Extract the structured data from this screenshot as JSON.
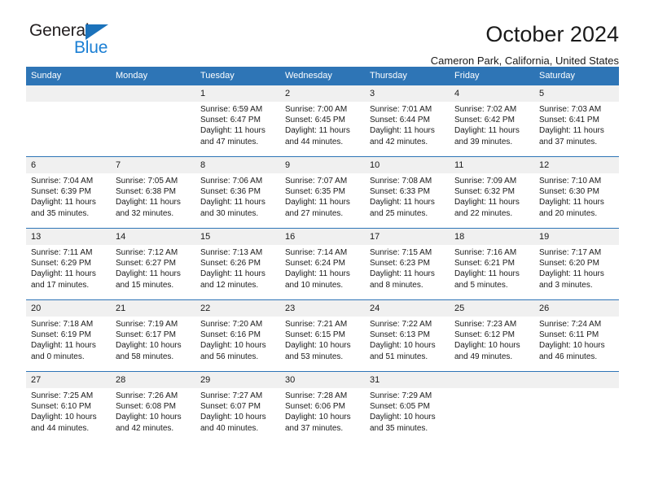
{
  "brand": {
    "name_top": "General",
    "name_bottom": "Blue",
    "accent_color": "#1b7fd4",
    "triangle_color": "#1b72bb"
  },
  "header": {
    "title": "October 2024",
    "subtitle": "Cameron Park, California, United States",
    "header_bg": "#2e75b6",
    "day_band_bg": "#f0f0f0"
  },
  "weekday_headers": [
    "Sunday",
    "Monday",
    "Tuesday",
    "Wednesday",
    "Thursday",
    "Friday",
    "Saturday"
  ],
  "weeks": [
    [
      {
        "day": "",
        "sunrise": "",
        "sunset": "",
        "daylight_line1": "",
        "daylight_line2": ""
      },
      {
        "day": "",
        "sunrise": "",
        "sunset": "",
        "daylight_line1": "",
        "daylight_line2": ""
      },
      {
        "day": "1",
        "sunrise": "Sunrise: 6:59 AM",
        "sunset": "Sunset: 6:47 PM",
        "daylight_line1": "Daylight: 11 hours",
        "daylight_line2": "and 47 minutes."
      },
      {
        "day": "2",
        "sunrise": "Sunrise: 7:00 AM",
        "sunset": "Sunset: 6:45 PM",
        "daylight_line1": "Daylight: 11 hours",
        "daylight_line2": "and 44 minutes."
      },
      {
        "day": "3",
        "sunrise": "Sunrise: 7:01 AM",
        "sunset": "Sunset: 6:44 PM",
        "daylight_line1": "Daylight: 11 hours",
        "daylight_line2": "and 42 minutes."
      },
      {
        "day": "4",
        "sunrise": "Sunrise: 7:02 AM",
        "sunset": "Sunset: 6:42 PM",
        "daylight_line1": "Daylight: 11 hours",
        "daylight_line2": "and 39 minutes."
      },
      {
        "day": "5",
        "sunrise": "Sunrise: 7:03 AM",
        "sunset": "Sunset: 6:41 PM",
        "daylight_line1": "Daylight: 11 hours",
        "daylight_line2": "and 37 minutes."
      }
    ],
    [
      {
        "day": "6",
        "sunrise": "Sunrise: 7:04 AM",
        "sunset": "Sunset: 6:39 PM",
        "daylight_line1": "Daylight: 11 hours",
        "daylight_line2": "and 35 minutes."
      },
      {
        "day": "7",
        "sunrise": "Sunrise: 7:05 AM",
        "sunset": "Sunset: 6:38 PM",
        "daylight_line1": "Daylight: 11 hours",
        "daylight_line2": "and 32 minutes."
      },
      {
        "day": "8",
        "sunrise": "Sunrise: 7:06 AM",
        "sunset": "Sunset: 6:36 PM",
        "daylight_line1": "Daylight: 11 hours",
        "daylight_line2": "and 30 minutes."
      },
      {
        "day": "9",
        "sunrise": "Sunrise: 7:07 AM",
        "sunset": "Sunset: 6:35 PM",
        "daylight_line1": "Daylight: 11 hours",
        "daylight_line2": "and 27 minutes."
      },
      {
        "day": "10",
        "sunrise": "Sunrise: 7:08 AM",
        "sunset": "Sunset: 6:33 PM",
        "daylight_line1": "Daylight: 11 hours",
        "daylight_line2": "and 25 minutes."
      },
      {
        "day": "11",
        "sunrise": "Sunrise: 7:09 AM",
        "sunset": "Sunset: 6:32 PM",
        "daylight_line1": "Daylight: 11 hours",
        "daylight_line2": "and 22 minutes."
      },
      {
        "day": "12",
        "sunrise": "Sunrise: 7:10 AM",
        "sunset": "Sunset: 6:30 PM",
        "daylight_line1": "Daylight: 11 hours",
        "daylight_line2": "and 20 minutes."
      }
    ],
    [
      {
        "day": "13",
        "sunrise": "Sunrise: 7:11 AM",
        "sunset": "Sunset: 6:29 PM",
        "daylight_line1": "Daylight: 11 hours",
        "daylight_line2": "and 17 minutes."
      },
      {
        "day": "14",
        "sunrise": "Sunrise: 7:12 AM",
        "sunset": "Sunset: 6:27 PM",
        "daylight_line1": "Daylight: 11 hours",
        "daylight_line2": "and 15 minutes."
      },
      {
        "day": "15",
        "sunrise": "Sunrise: 7:13 AM",
        "sunset": "Sunset: 6:26 PM",
        "daylight_line1": "Daylight: 11 hours",
        "daylight_line2": "and 12 minutes."
      },
      {
        "day": "16",
        "sunrise": "Sunrise: 7:14 AM",
        "sunset": "Sunset: 6:24 PM",
        "daylight_line1": "Daylight: 11 hours",
        "daylight_line2": "and 10 minutes."
      },
      {
        "day": "17",
        "sunrise": "Sunrise: 7:15 AM",
        "sunset": "Sunset: 6:23 PM",
        "daylight_line1": "Daylight: 11 hours",
        "daylight_line2": "and 8 minutes."
      },
      {
        "day": "18",
        "sunrise": "Sunrise: 7:16 AM",
        "sunset": "Sunset: 6:21 PM",
        "daylight_line1": "Daylight: 11 hours",
        "daylight_line2": "and 5 minutes."
      },
      {
        "day": "19",
        "sunrise": "Sunrise: 7:17 AM",
        "sunset": "Sunset: 6:20 PM",
        "daylight_line1": "Daylight: 11 hours",
        "daylight_line2": "and 3 minutes."
      }
    ],
    [
      {
        "day": "20",
        "sunrise": "Sunrise: 7:18 AM",
        "sunset": "Sunset: 6:19 PM",
        "daylight_line1": "Daylight: 11 hours",
        "daylight_line2": "and 0 minutes."
      },
      {
        "day": "21",
        "sunrise": "Sunrise: 7:19 AM",
        "sunset": "Sunset: 6:17 PM",
        "daylight_line1": "Daylight: 10 hours",
        "daylight_line2": "and 58 minutes."
      },
      {
        "day": "22",
        "sunrise": "Sunrise: 7:20 AM",
        "sunset": "Sunset: 6:16 PM",
        "daylight_line1": "Daylight: 10 hours",
        "daylight_line2": "and 56 minutes."
      },
      {
        "day": "23",
        "sunrise": "Sunrise: 7:21 AM",
        "sunset": "Sunset: 6:15 PM",
        "daylight_line1": "Daylight: 10 hours",
        "daylight_line2": "and 53 minutes."
      },
      {
        "day": "24",
        "sunrise": "Sunrise: 7:22 AM",
        "sunset": "Sunset: 6:13 PM",
        "daylight_line1": "Daylight: 10 hours",
        "daylight_line2": "and 51 minutes."
      },
      {
        "day": "25",
        "sunrise": "Sunrise: 7:23 AM",
        "sunset": "Sunset: 6:12 PM",
        "daylight_line1": "Daylight: 10 hours",
        "daylight_line2": "and 49 minutes."
      },
      {
        "day": "26",
        "sunrise": "Sunrise: 7:24 AM",
        "sunset": "Sunset: 6:11 PM",
        "daylight_line1": "Daylight: 10 hours",
        "daylight_line2": "and 46 minutes."
      }
    ],
    [
      {
        "day": "27",
        "sunrise": "Sunrise: 7:25 AM",
        "sunset": "Sunset: 6:10 PM",
        "daylight_line1": "Daylight: 10 hours",
        "daylight_line2": "and 44 minutes."
      },
      {
        "day": "28",
        "sunrise": "Sunrise: 7:26 AM",
        "sunset": "Sunset: 6:08 PM",
        "daylight_line1": "Daylight: 10 hours",
        "daylight_line2": "and 42 minutes."
      },
      {
        "day": "29",
        "sunrise": "Sunrise: 7:27 AM",
        "sunset": "Sunset: 6:07 PM",
        "daylight_line1": "Daylight: 10 hours",
        "daylight_line2": "and 40 minutes."
      },
      {
        "day": "30",
        "sunrise": "Sunrise: 7:28 AM",
        "sunset": "Sunset: 6:06 PM",
        "daylight_line1": "Daylight: 10 hours",
        "daylight_line2": "and 37 minutes."
      },
      {
        "day": "31",
        "sunrise": "Sunrise: 7:29 AM",
        "sunset": "Sunset: 6:05 PM",
        "daylight_line1": "Daylight: 10 hours",
        "daylight_line2": "and 35 minutes."
      },
      {
        "day": "",
        "sunrise": "",
        "sunset": "",
        "daylight_line1": "",
        "daylight_line2": ""
      },
      {
        "day": "",
        "sunrise": "",
        "sunset": "",
        "daylight_line1": "",
        "daylight_line2": ""
      }
    ]
  ]
}
